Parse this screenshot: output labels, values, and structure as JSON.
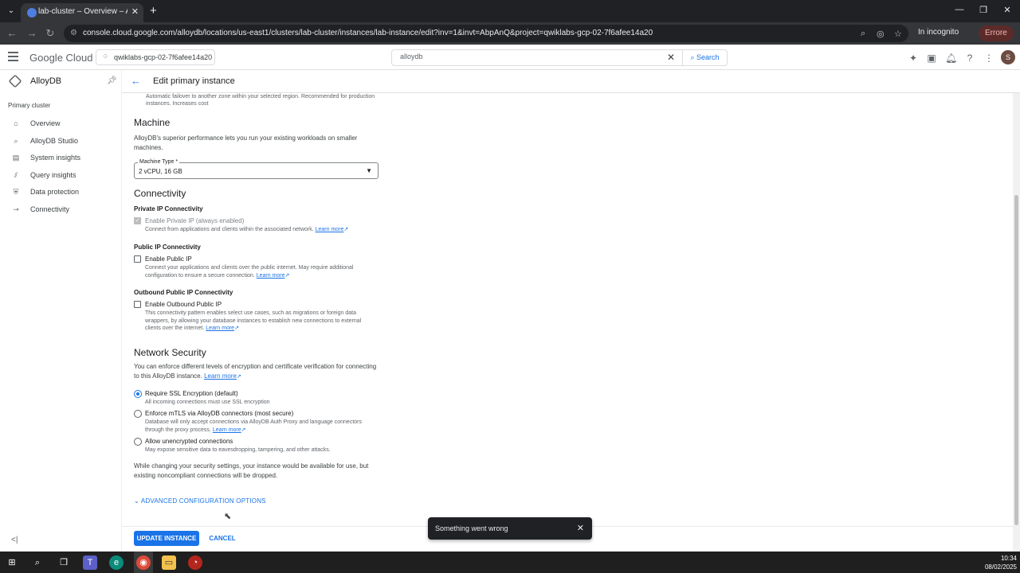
{
  "browser": {
    "tab_title": "lab-cluster – Overview – AlloyDB",
    "url": "console.cloud.google.com/alloydb/locations/us-east1/clusters/lab-cluster/instances/lab-instance/edit?inv=1&invt=AbpAnQ&project=qwiklabs-gcp-02-7f6afee14a20",
    "incognito_label": "In incognito",
    "error_badge": "Errore"
  },
  "gcp_header": {
    "logo": "Google Cloud",
    "project": "qwiklabs-gcp-02-7f6afee14a20",
    "search_value": "alloydb",
    "search_button": "Search",
    "avatar_letter": "S"
  },
  "sidebar": {
    "product": "AlloyDB",
    "section": "Primary cluster",
    "items": [
      {
        "label": "Overview",
        "icon": "overview-icon"
      },
      {
        "label": "AlloyDB Studio",
        "icon": "studio-search-icon"
      },
      {
        "label": "System insights",
        "icon": "system-insights-icon"
      },
      {
        "label": "Query insights",
        "icon": "query-insights-icon"
      },
      {
        "label": "Data protection",
        "icon": "shield-icon"
      },
      {
        "label": "Connectivity",
        "icon": "connectivity-icon"
      }
    ]
  },
  "page": {
    "title": "Edit primary instance",
    "top_note": "Automatic failover to another zone within your selected region. Recommended for production instances. Increases cost",
    "machine": {
      "heading": "Machine",
      "desc": "AlloyDB's superior performance lets you run your existing workloads on smaller machines.",
      "select_label": "Machine Type *",
      "select_value": "2 vCPU, 16 GB"
    },
    "connectivity": {
      "heading": "Connectivity",
      "private_title": "Private IP Connectivity",
      "private_label": "Enable Private IP (always enabled)",
      "private_desc": "Connect from applications and clients within the associated network.",
      "public_title": "Public IP Connectivity",
      "public_label": "Enable Public IP",
      "public_desc": "Connect your applications and clients over the public internet. May require additional configuration to ensure a secure connection.",
      "outbound_title": "Outbound Public IP Connectivity",
      "outbound_label": "Enable Outbound Public IP",
      "outbound_desc": "This connectivity pattern enables select use cases, such as migrations or foreign data wrappers, by allowing your database instances to establish new connections to external clients over the internet.",
      "learn_more": "Learn more"
    },
    "security": {
      "heading": "Network Security",
      "desc": "You can enforce different levels of encryption and certificate verification for connecting to this AlloyDB instance.",
      "options": [
        {
          "label": "Require SSL Encryption (default)",
          "desc": "All incoming connections must use SSL encryption",
          "selected": true
        },
        {
          "label": "Enforce mTLS via AlloyDB connectors (most secure)",
          "desc": "Database will only accept connections via AlloyDB Auth Proxy and language connectors through the proxy process.",
          "selected": false
        },
        {
          "label": "Allow unencrypted connections",
          "desc": "May expose sensitive data to eavesdropping, tampering, and other attacks.",
          "selected": false
        }
      ],
      "note": "While changing your security settings, your instance would be available for use, but existing noncompliant connections will be dropped."
    },
    "advanced": "ADVANCED CONFIGURATION OPTIONS"
  },
  "actions": {
    "update": "UPDATE INSTANCE",
    "cancel": "CANCEL"
  },
  "snackbar": "Something went wrong",
  "taskbar": {
    "time": "10:34",
    "date": "08/02/2025"
  }
}
